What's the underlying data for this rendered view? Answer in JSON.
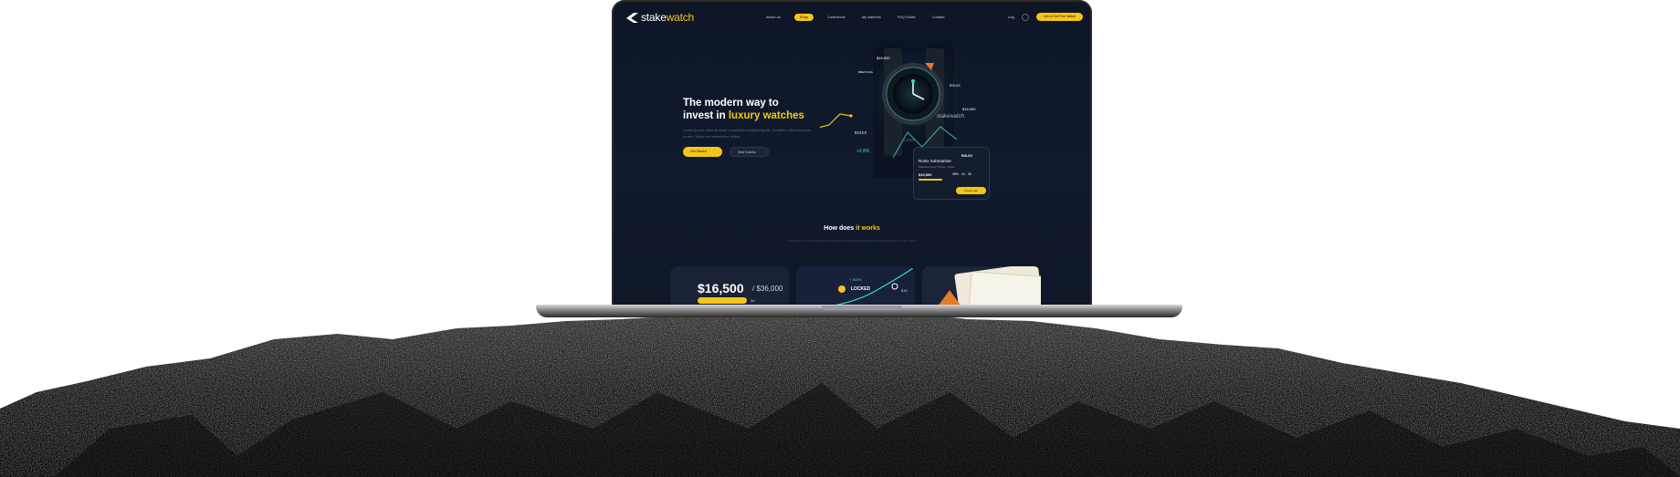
{
  "site": {
    "logo": {
      "part1": "stake",
      "part2": "watch"
    },
    "nav": {
      "links": [
        "About us",
        "Shop",
        "Collections",
        "My watches",
        "FAQ Guide",
        "Contact"
      ],
      "active_index": 1,
      "login": "Log",
      "cta": "Join & Get Free Watch"
    },
    "hero": {
      "title_line1": "The modern way to",
      "title_line2_prefix": "invest in ",
      "title_accent": "luxury watches",
      "subtitle": "Lorem ipsum dolor sit amet consectetur adipiscing elit. Curabitur vehicula porta ornare. Nulla nec elementum tellus.",
      "primary_button": "Get Started",
      "secondary_button": "How it works"
    },
    "widget": {
      "brand": "ROLEX",
      "title": "Rolex Submariner",
      "subtitle": "Stainless steel | 41mm | 2023",
      "price": "$16,500",
      "stats": "35% 14 30",
      "button": "Invest now"
    },
    "hero_badges": {
      "price_top": "$16,500",
      "price_right": "$15,500",
      "percent": "+2.8%",
      "brand_rolex": "ROLEX",
      "brand_breitling": "BREITLING",
      "brand_cartier": "Cartier",
      "stakewatch_tag": "stakewatch"
    },
    "how": {
      "title_prefix": "How does ",
      "title_accent": "it works",
      "subtitle": "Lorem ipsum dolor sit amet consectetur adipiscing elit curabitur vehicula porta ornare nulla."
    },
    "cards": {
      "price": "$16,500",
      "total": "/ $36,000",
      "small": "3d",
      "percent": "+ 800%",
      "locked": "LOCKED",
      "value": "$15"
    }
  },
  "colors": {
    "accent": "#f5c518",
    "screen_bg": "#0e1626",
    "teal": "#2de0c4"
  }
}
